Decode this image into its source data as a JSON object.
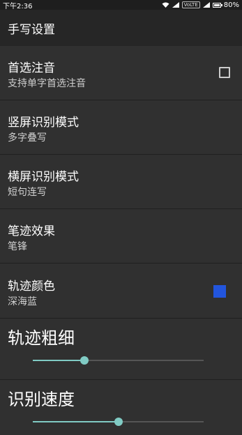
{
  "status_bar": {
    "time": "下午2:36",
    "volte": "VoLTE",
    "battery": "80%"
  },
  "app_bar": {
    "title": "手写设置"
  },
  "preferences": [
    {
      "title": "首选注音",
      "summary": "支持单字首选注音",
      "widget": "checkbox",
      "checked": false
    },
    {
      "title": "竖屏识别模式",
      "summary": "多字叠写"
    },
    {
      "title": "横屏识别模式",
      "summary": "短句连写"
    },
    {
      "title": "笔迹效果",
      "summary": "笔锋"
    },
    {
      "title": "轨迹颜色",
      "summary": "深海蓝",
      "widget": "color",
      "color": "#2255dd"
    }
  ],
  "sliders": [
    {
      "title": "轨迹粗细",
      "value": 0.3
    },
    {
      "title": "识别速度",
      "value": 0.5
    }
  ],
  "colors": {
    "accent": "#80cbc4",
    "background": "#303030",
    "app_bar": "#262626"
  }
}
